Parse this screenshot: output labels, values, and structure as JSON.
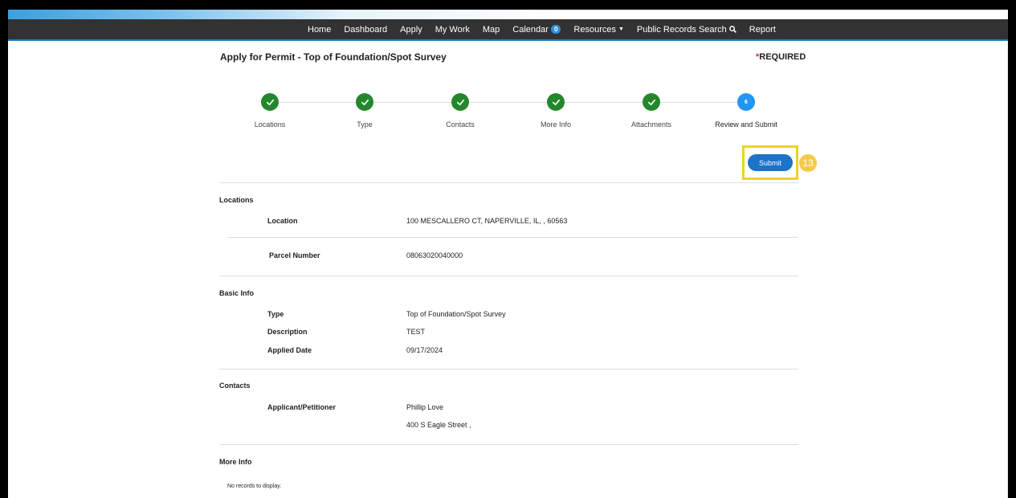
{
  "nav": {
    "items": [
      "Home",
      "Dashboard",
      "Apply",
      "My Work",
      "Map"
    ],
    "calendar_label": "Calendar",
    "calendar_count": "0",
    "resources_label": "Resources",
    "public_search_label": "Public Records Search",
    "report_label": "Report"
  },
  "page": {
    "title": "Apply for Permit - Top of Foundation/Spot Survey",
    "required_star": "*",
    "required_text": "REQUIRED"
  },
  "steps": [
    {
      "label": "Locations",
      "status": "complete"
    },
    {
      "label": "Type",
      "status": "complete"
    },
    {
      "label": "Contacts",
      "status": "complete"
    },
    {
      "label": "More Info",
      "status": "complete"
    },
    {
      "label": "Attachments",
      "status": "complete"
    },
    {
      "label": "Review and Submit",
      "status": "current",
      "number": "6"
    }
  ],
  "submit": {
    "label": "Submit",
    "annotation": "13"
  },
  "sections": {
    "locations": {
      "title": "Locations",
      "location_label": "Location",
      "location_value": "100 MESCALLERO CT, NAPERVILLE, IL, , 60563",
      "parcel_label": "Parcel Number",
      "parcel_value": "08063020040000"
    },
    "basic_info": {
      "title": "Basic Info",
      "type_label": "Type",
      "type_value": "Top of Foundation/Spot Survey",
      "description_label": "Description",
      "description_value": "TEST",
      "applied_label": "Applied Date",
      "applied_value": "09/17/2024"
    },
    "contacts": {
      "title": "Contacts",
      "applicant_label": "Applicant/Petitioner",
      "applicant_name": "Phillip Love",
      "applicant_address": "400 S Eagle Street ,"
    },
    "more_info": {
      "title": "More Info",
      "empty_text": "No records to display."
    }
  },
  "colors": {
    "nav_bg": "#323232",
    "step_done": "#24872d",
    "step_current": "#2196f3",
    "primary_button": "#1c73c9",
    "highlight": "#f2d21a",
    "annotation_marker": "#f7c948"
  }
}
